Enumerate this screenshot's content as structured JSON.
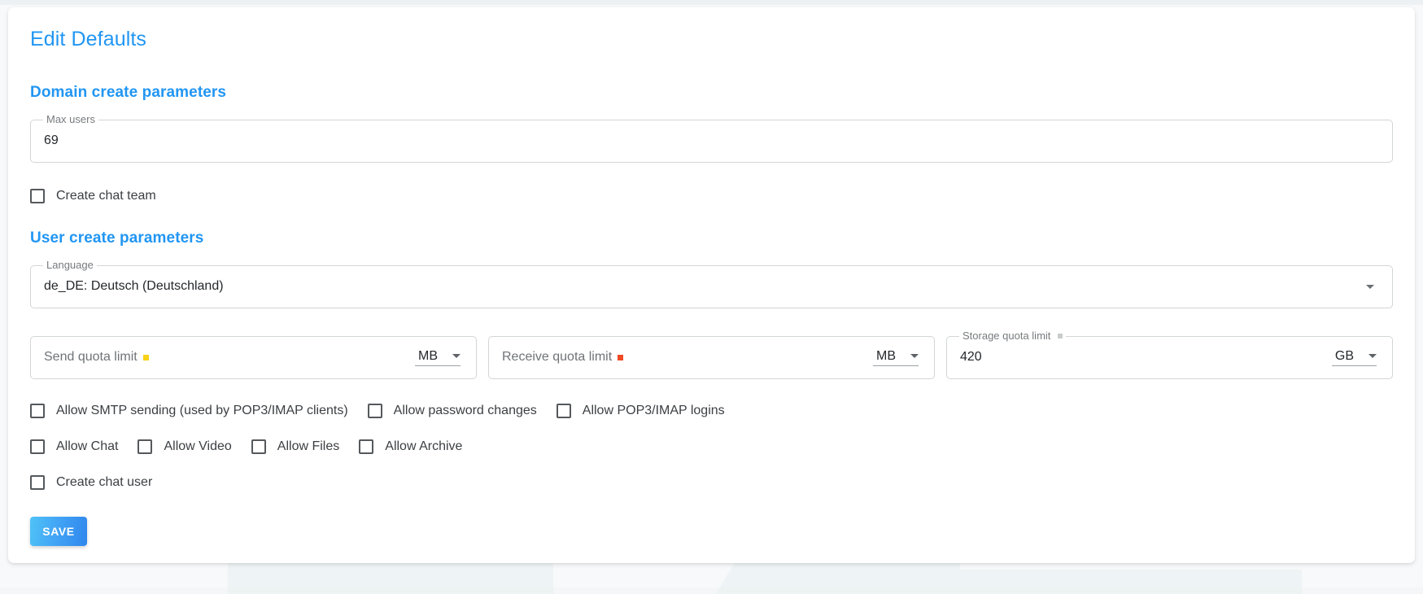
{
  "page": {
    "title": "Edit Defaults",
    "accent_color": "#2196f3"
  },
  "sections": {
    "domain": {
      "title": "Domain create parameters",
      "max_users": {
        "label": "Max users",
        "value": "69"
      },
      "create_chat_team": {
        "label": "Create chat team",
        "checked": false
      }
    },
    "user": {
      "title": "User create parameters",
      "language": {
        "label": "Language",
        "value": "de_DE: Deutsch (Deutschland)"
      },
      "quotas": [
        {
          "name": "send-quota-limit",
          "label": "Send quota limit",
          "value": "",
          "placeholder": "Send quota limit",
          "marker_color": "#f7d117",
          "unit": "MB",
          "floating": false
        },
        {
          "name": "receive-quota-limit",
          "label": "Receive quota limit",
          "value": "",
          "placeholder": "Receive quota limit",
          "marker_color": "#ef4a23",
          "unit": "MB",
          "floating": false
        },
        {
          "name": "storage-quota-limit",
          "label": "Storage quota limit",
          "value": "420",
          "placeholder": "Storage quota limit",
          "marker_color": "#c9cccd",
          "unit": "GB",
          "floating": true
        }
      ],
      "permissions_row1": [
        {
          "name": "allow-smtp-sending",
          "label": "Allow SMTP sending (used by POP3/IMAP clients)",
          "checked": false
        },
        {
          "name": "allow-password-changes",
          "label": "Allow password changes",
          "checked": false
        },
        {
          "name": "allow-pop3-imap-logins",
          "label": "Allow POP3/IMAP logins",
          "checked": false
        }
      ],
      "permissions_row2": [
        {
          "name": "allow-chat",
          "label": "Allow Chat",
          "checked": false
        },
        {
          "name": "allow-video",
          "label": "Allow Video",
          "checked": false
        },
        {
          "name": "allow-files",
          "label": "Allow Files",
          "checked": false
        },
        {
          "name": "allow-archive",
          "label": "Allow Archive",
          "checked": false
        }
      ],
      "create_chat_user": {
        "label": "Create chat user",
        "checked": false
      }
    }
  },
  "actions": {
    "save_label": "SAVE"
  }
}
